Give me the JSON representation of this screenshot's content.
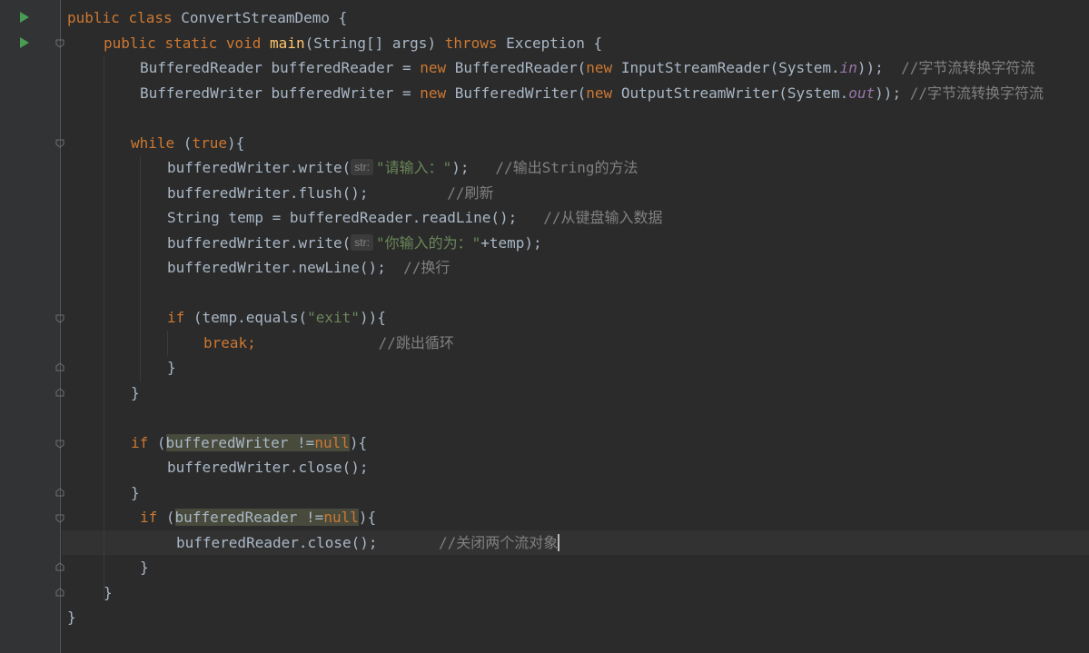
{
  "editor": {
    "lines": [
      {
        "p": [
          "public ",
          "class ",
          "ConvertStreamDemo {"
        ]
      },
      {
        "p": [
          "public ",
          "static ",
          "void ",
          "main",
          "(String[] args) ",
          "throws ",
          "Exception {"
        ]
      },
      {
        "p": [
          "BufferedReader bufferedReader = ",
          "new ",
          "BufferedReader(",
          "new ",
          "InputStreamReader(System.",
          "in",
          "));  ",
          "//字节流转换字符流"
        ]
      },
      {
        "p": [
          "BufferedWriter bufferedWriter = ",
          "new ",
          "BufferedWriter(",
          "new ",
          "OutputStreamWriter(System.",
          "out",
          ")); ",
          "//字节流转换字符流"
        ]
      },
      {
        "p": [
          "while ",
          "(",
          "true",
          "){"
        ]
      },
      {
        "p": [
          "bufferedWriter.write(",
          "str:",
          "\"请输入：\"",
          ");   ",
          "//输出String的方法"
        ]
      },
      {
        "p": [
          "bufferedWriter.flush();         ",
          "//刷新"
        ]
      },
      {
        "p": [
          "String temp = bufferedReader.readLine();   ",
          "//从键盘输入数据"
        ]
      },
      {
        "p": [
          "bufferedWriter.write(",
          "str:",
          "\"你输入的为：\"",
          "+temp);"
        ]
      },
      {
        "p": [
          "bufferedWriter.newLine();  ",
          "//换行"
        ]
      },
      {
        "p": [
          "if ",
          "(temp.equals(",
          "\"exit\"",
          ")){"
        ]
      },
      {
        "p": [
          "break;",
          "              ",
          "//跳出循环"
        ]
      },
      {
        "p": [
          "}"
        ]
      },
      {
        "p": [
          "}"
        ]
      },
      {
        "p": [
          "if ",
          "(",
          "bufferedWriter !=",
          "null",
          "){"
        ]
      },
      {
        "p": [
          "bufferedWriter.close();"
        ]
      },
      {
        "p": [
          "}"
        ]
      },
      {
        "p": [
          "if ",
          "(",
          "bufferedReader !=",
          "null",
          "){"
        ]
      },
      {
        "p": [
          "bufferedReader.close();",
          "       ",
          "//关闭两个流对象"
        ]
      },
      {
        "p": [
          "}"
        ]
      },
      {
        "p": [
          "}"
        ]
      },
      {
        "p": [
          "}"
        ]
      }
    ]
  },
  "colors": {
    "background": "#2b2b2b",
    "gutter": "#313335",
    "keyword": "#cc7832",
    "method": "#ffc66d",
    "string": "#6a8759",
    "comment": "#808080",
    "static_field": "#9876aa",
    "text": "#a9b7c6"
  },
  "icons": [
    "run-icon",
    "fold-icon"
  ]
}
